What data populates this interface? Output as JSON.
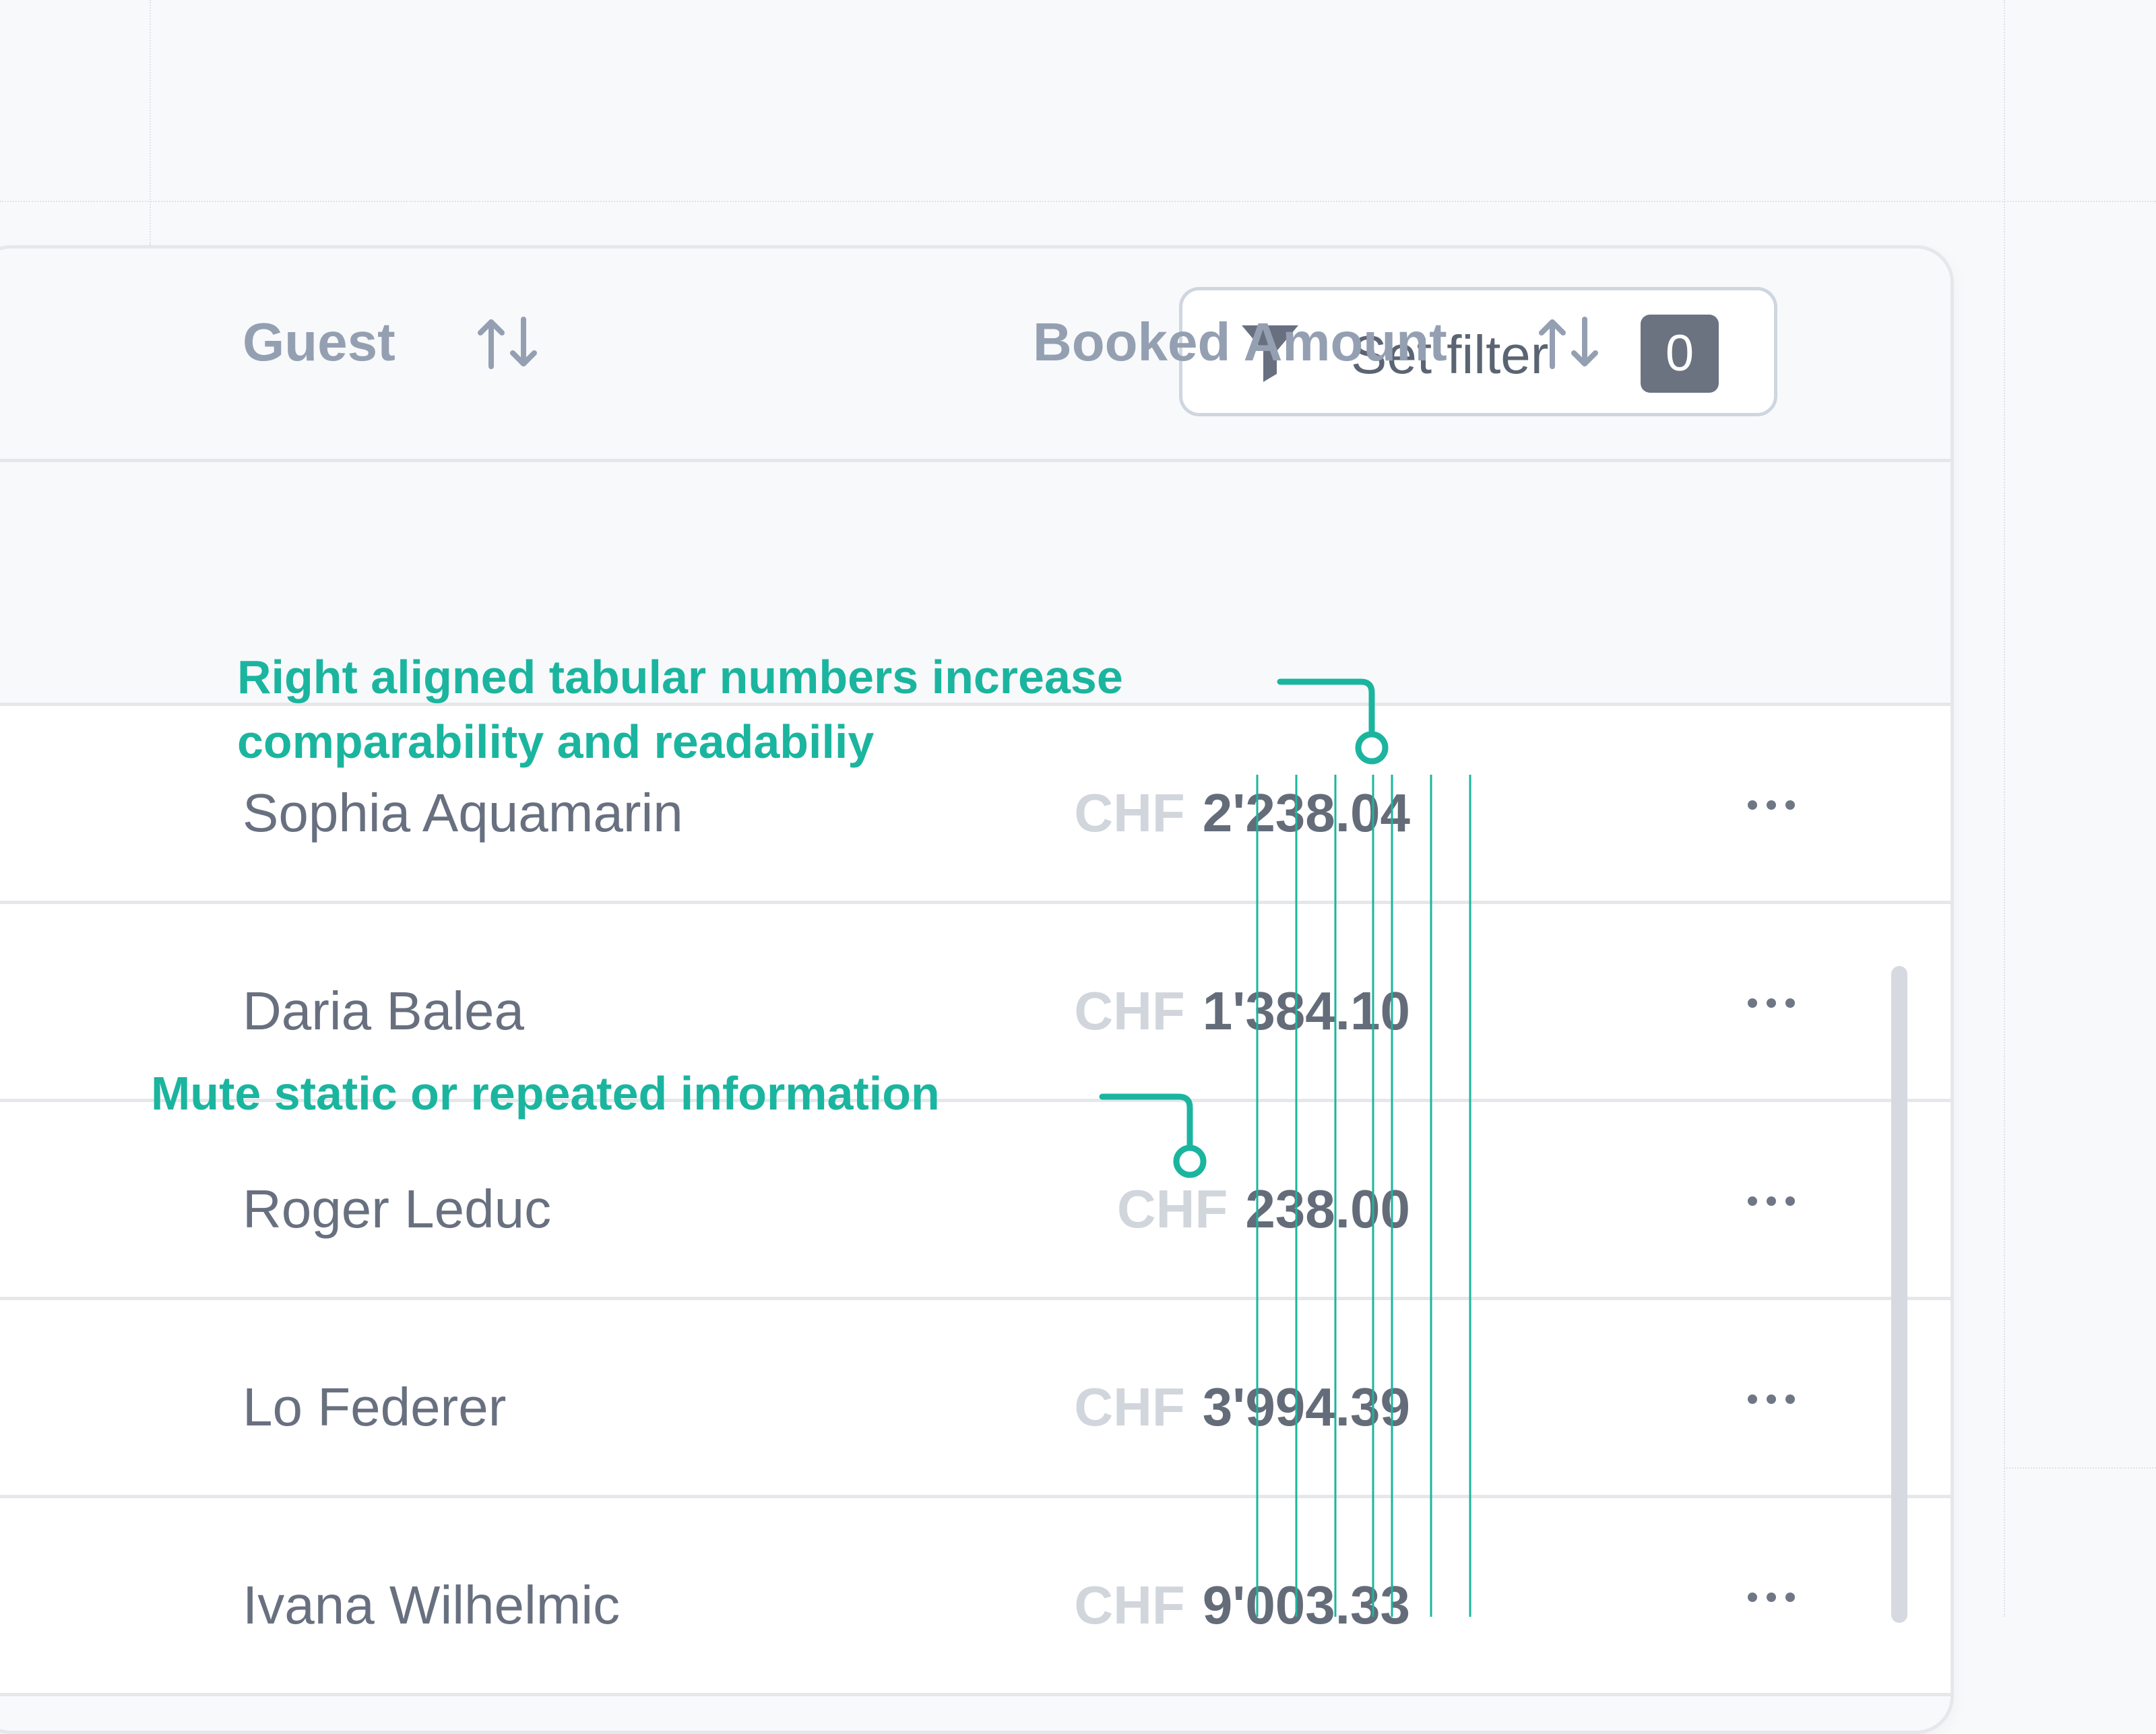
{
  "toolbar": {
    "filter_label": "Set filter",
    "filter_count": "0",
    "filter_icon": "filter-icon"
  },
  "table": {
    "columns": [
      {
        "label": "Guest",
        "sort_icon": "sort-icon"
      },
      {
        "label": "Booked Amount",
        "sort_icon": "sort-icon"
      }
    ],
    "rows": [
      {
        "guest": "Sophia Aquamarin",
        "currency": "CHF",
        "amount": "2'238.04",
        "actions_icon": "more-icon"
      },
      {
        "guest": "Daria Balea",
        "currency": "CHF",
        "amount": "1'384.10",
        "actions_icon": "more-icon"
      },
      {
        "guest": "Roger Leduc",
        "currency": "CHF",
        "amount": "238.00",
        "actions_icon": "more-icon"
      },
      {
        "guest": "Lo Federer",
        "currency": "CHF",
        "amount": "3'994.39",
        "actions_icon": "more-icon"
      },
      {
        "guest": "Ivana Wilhelmic",
        "currency": "CHF",
        "amount": "9'003.33",
        "actions_icon": "more-icon"
      }
    ]
  },
  "annotations": {
    "right_aligned": {
      "line_1": "Right aligned tabular numbers increase",
      "line_2": "comparability and readabiliy"
    },
    "mute_static": "Mute static or repeated information"
  },
  "colors": {
    "accent": "#1bb59f",
    "muted_text": "#d1d5dc",
    "strong_text": "#646c79",
    "header_text": "#94a0b2",
    "badge": "#6b7280"
  }
}
